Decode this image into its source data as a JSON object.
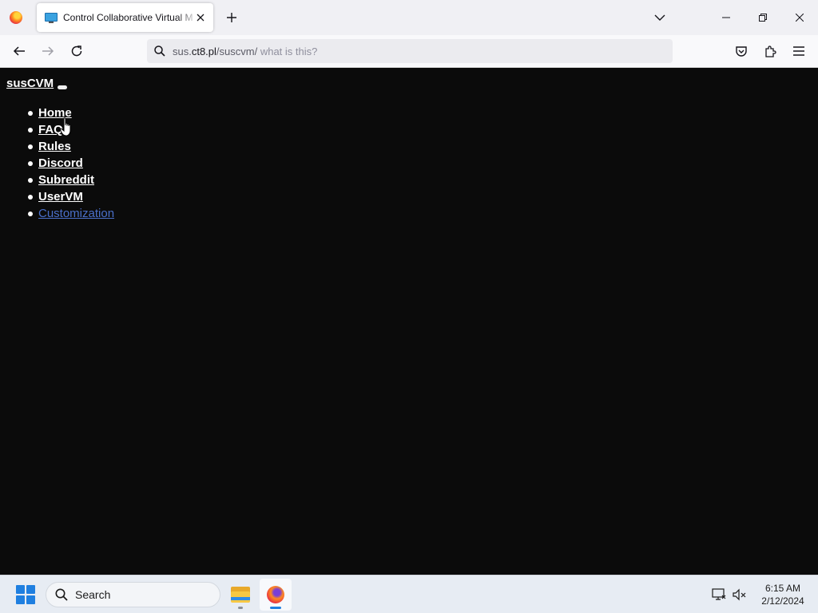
{
  "browser": {
    "tab": {
      "title": "Control Collaborative Virtual M"
    },
    "url": {
      "prefix": "sus.",
      "host": "ct8.pl",
      "path": "/suscvm/",
      "extra": " what is this?"
    }
  },
  "page": {
    "brand": "susCVM",
    "menu": [
      {
        "label": "Home"
      },
      {
        "label": "FAQ"
      },
      {
        "label": "Rules"
      },
      {
        "label": "Discord"
      },
      {
        "label": "Subreddit"
      },
      {
        "label": "UserVM"
      },
      {
        "label": "Customization"
      }
    ]
  },
  "taskbar": {
    "search_placeholder": "Search",
    "time": "6:15 AM",
    "date": "2/12/2024"
  },
  "colors": {
    "page_bg": "#0b0b0b",
    "link_active": "#4a6fc9",
    "accent": "#1f7fe0"
  }
}
